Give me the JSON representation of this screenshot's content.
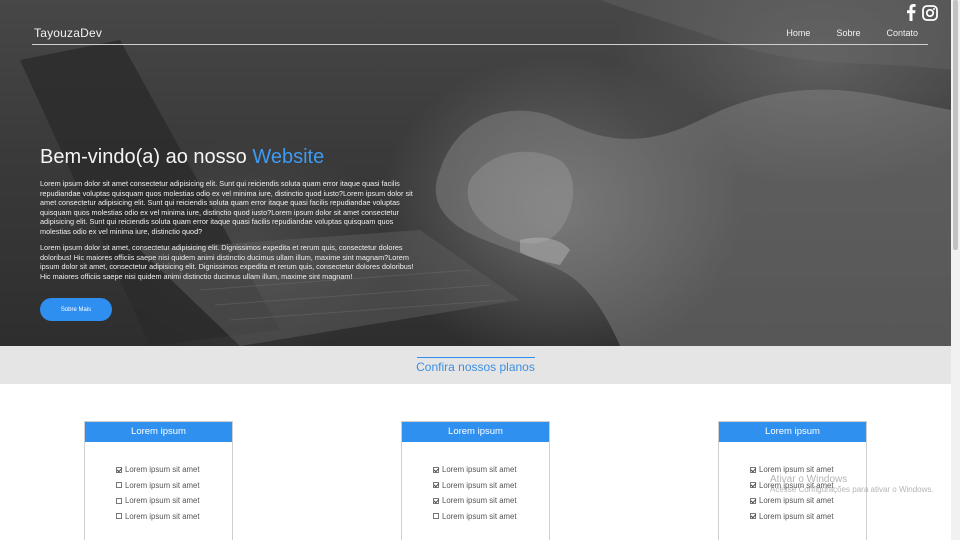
{
  "header": {
    "brand": "TayouzaDev",
    "nav": [
      "Home",
      "Sobre",
      "Contato"
    ],
    "social": [
      "facebook-icon",
      "instagram-icon"
    ]
  },
  "hero": {
    "title_plain": "Bem-vindo(a) ao nosso ",
    "title_accent": "Website",
    "paragraph1": "Lorem ipsum dolor sit amet consectetur adipisicing elit. Sunt qui reiciendis soluta quam error itaque quasi facilis repudiandae voluptas quisquam quos molestias odio ex vel minima iure, distinctio quod iusto?Lorem ipsum dolor sit amet consectetur adipisicing elit. Sunt qui reiciendis soluta quam error itaque quasi facilis repudiandae voluptas quisquam quos molestias odio ex vel minima iure, distinctio quod iusto?Lorem ipsum dolor sit amet consectetur adipisicing elit. Sunt qui reiciendis soluta quam error itaque quasi facilis repudiandae voluptas quisquam quos molestias odio ex vel minima iure, distinctio quod?",
    "paragraph2": "Lorem ipsum dolor sit amet, consectetur adipisicing elit. Dignissimos expedita et rerum quis, consectetur dolores doloribus! Hic maiores officiis saepe nisi quidem animi distinctio ducimus ullam illum, maxime sint magnam?Lorem ipsum dolor sit amet, consectetur adipisicing elit. Dignissimos expedita et rerum quis, consectetur dolores doloribus! Hic maiores officiis saepe nisi quidem animi distinctio ducimus ullam illum, maxime sint magnam!",
    "button": "Sobre Mais"
  },
  "plans": {
    "heading": "Confira nossos planos",
    "cards": [
      {
        "title": "Lorem ipsum",
        "items": [
          {
            "label": "Lorem ipsum sit amet",
            "checked": true
          },
          {
            "label": "Lorem ipsum sit amet",
            "checked": false
          },
          {
            "label": "Lorem ipsum sit amet",
            "checked": false
          },
          {
            "label": "Lorem ipsum sit amet",
            "checked": false
          }
        ]
      },
      {
        "title": "Lorem ipsum",
        "items": [
          {
            "label": "Lorem ipsum sit amet",
            "checked": true
          },
          {
            "label": "Lorem ipsum sit amet",
            "checked": true
          },
          {
            "label": "Lorem ipsum sit amet",
            "checked": true
          },
          {
            "label": "Lorem ipsum sit amet",
            "checked": false
          }
        ]
      },
      {
        "title": "Lorem ipsum",
        "items": [
          {
            "label": "Lorem ipsum sit amet",
            "checked": true
          },
          {
            "label": "Lorem ipsum sit amet",
            "checked": true
          },
          {
            "label": "Lorem ipsum sit amet",
            "checked": true
          },
          {
            "label": "Lorem ipsum sit amet",
            "checked": true
          }
        ]
      }
    ]
  },
  "watermark": {
    "line1": "Ativar o Windows",
    "line2": "Acesse Configurações para ativar o Windows."
  },
  "colors": {
    "accent": "#2f8ff0",
    "hero_bg": "#3a3a3a",
    "strip_bg": "#e5e5e5"
  }
}
